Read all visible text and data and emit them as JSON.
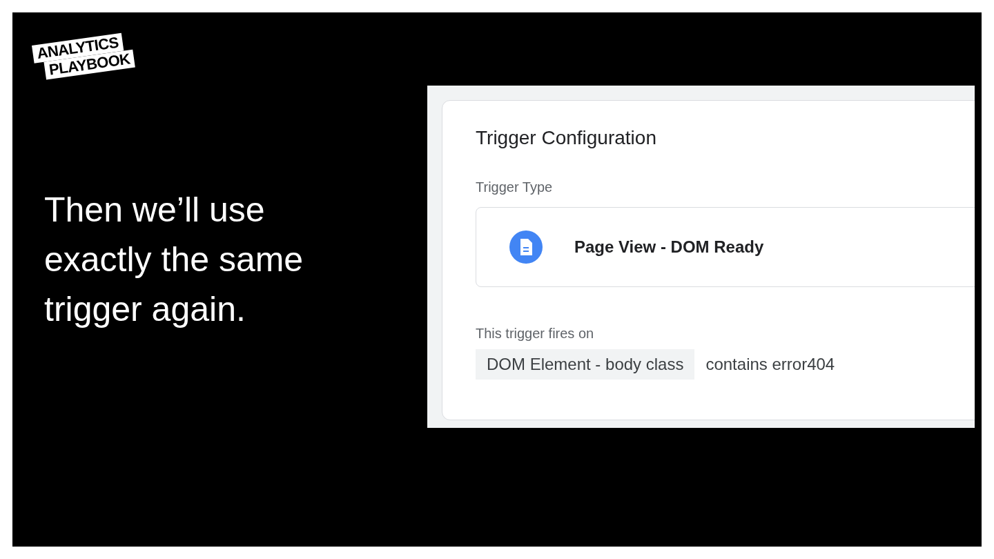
{
  "logo": {
    "lines": [
      "ANALYTICS",
      "PLAYBOOK"
    ]
  },
  "headline": "Then we’ll use exactly the same trigger again.",
  "screenshot": {
    "title": "Trigger Configuration",
    "type_label": "Trigger Type",
    "trigger_type": "Page View - DOM Ready",
    "fires_label": "This trigger fires on",
    "condition": {
      "variable": "DOM Element - body class",
      "rule": "contains error404"
    }
  }
}
